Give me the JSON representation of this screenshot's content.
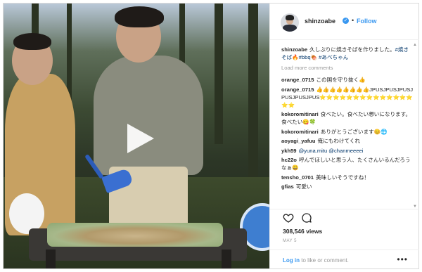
{
  "post": {
    "username": "shinzoabe",
    "follow_label": "Follow",
    "separator": "•",
    "verified_glyph": "✓"
  },
  "caption": {
    "username": "shinzoabe",
    "text": "久しぶりに焼きそばを作りました。",
    "tags": [
      "#焼きそば",
      "#bbq",
      "#あべちゃん"
    ]
  },
  "load_more": "Load more comments",
  "comments": [
    {
      "user": "orange_0715",
      "text": "この国を守り抜く👍"
    },
    {
      "user": "orange_0715",
      "text": "👍👍👍👍👍👍👍👍JPUSJPUSJPUSJPUSJPUSJPUS⭐⭐⭐⭐⭐⭐⭐⭐⭐⭐⭐⭐⭐⭐⭐⭐"
    },
    {
      "user": "kokoromitinari",
      "text": "食べたい。食べたい想いになります。食べたい😋🍀"
    },
    {
      "user": "kokoromitinari",
      "text": "ありがとうございます😊🌐"
    },
    {
      "user": "aoyagi_yafuu",
      "text": "俺にもわけてくれ"
    },
    {
      "user": "ykh59",
      "text": "@yuna.mitu @chanmeeeei"
    },
    {
      "user": "hc22o",
      "text": "呼んでほしいと思う人、たくさんいるんだろうなぁ😄"
    },
    {
      "user": "tensho_0701",
      "text": "美味しいそうですね！"
    },
    {
      "user": "gfias",
      "text": "可愛い"
    }
  ],
  "stats": {
    "views": "308,546 views",
    "date": "MAY 5"
  },
  "footer": {
    "login_link": "Log in",
    "login_rest": " to like or comment.",
    "more_glyph": "•••"
  },
  "icons": {
    "heart": "heart-icon",
    "comment": "comment-icon",
    "play": "play-icon"
  }
}
